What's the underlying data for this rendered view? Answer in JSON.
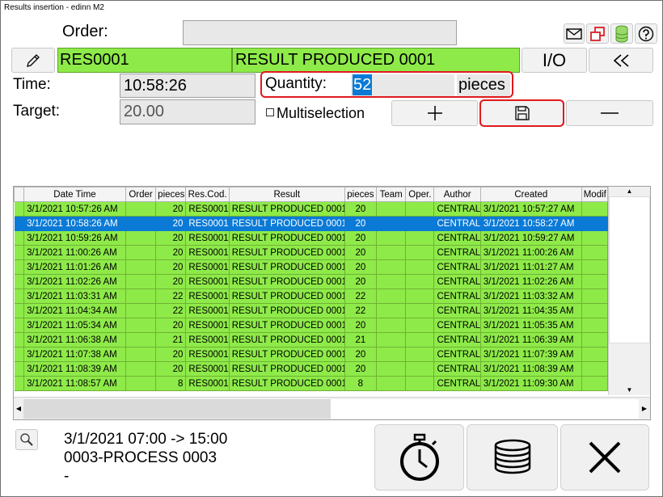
{
  "window": {
    "title": "Results insertion - edinn M2"
  },
  "form": {
    "order_label": "Order:",
    "order_value": "",
    "result_code": "RES0001",
    "result_name": "RESULT PRODUCED 0001",
    "io_label": "I/O",
    "time_label": "Time:",
    "time_value": "10:58:26",
    "quantity_label": "Quantity:",
    "quantity_value": "52",
    "quantity_unit": "pieces",
    "target_label": "Target:",
    "target_value": "20.00",
    "multiselection_label": "Multiselection"
  },
  "table": {
    "columns": [
      "Date Time",
      "Order",
      "pieces",
      "Res.Cod.",
      "Result",
      "pieces",
      "Team",
      "Oper.",
      "Author",
      "Created",
      "Modif"
    ],
    "rows": [
      [
        "3/1/2021 10:57:26 AM",
        "",
        "20",
        "RES0001",
        "RESULT PRODUCED 0001",
        "20",
        "",
        "",
        "CENTRAL",
        "3/1/2021 10:57:27 AM",
        ""
      ],
      [
        "3/1/2021 10:58:26 AM",
        "",
        "20",
        "RES0001",
        "RESULT PRODUCED 0001",
        "20",
        "",
        "",
        "CENTRAL",
        "3/1/2021 10:58:27 AM",
        ""
      ],
      [
        "3/1/2021 10:59:26 AM",
        "",
        "20",
        "RES0001",
        "RESULT PRODUCED 0001",
        "20",
        "",
        "",
        "CENTRAL",
        "3/1/2021 10:59:27 AM",
        ""
      ],
      [
        "3/1/2021 11:00:26 AM",
        "",
        "20",
        "RES0001",
        "RESULT PRODUCED 0001",
        "20",
        "",
        "",
        "CENTRAL",
        "3/1/2021 11:00:26 AM",
        ""
      ],
      [
        "3/1/2021 11:01:26 AM",
        "",
        "20",
        "RES0001",
        "RESULT PRODUCED 0001",
        "20",
        "",
        "",
        "CENTRAL",
        "3/1/2021 11:01:27 AM",
        ""
      ],
      [
        "3/1/2021 11:02:26 AM",
        "",
        "20",
        "RES0001",
        "RESULT PRODUCED 0001",
        "20",
        "",
        "",
        "CENTRAL",
        "3/1/2021 11:02:26 AM",
        ""
      ],
      [
        "3/1/2021 11:03:31 AM",
        "",
        "22",
        "RES0001",
        "RESULT PRODUCED 0001",
        "22",
        "",
        "",
        "CENTRAL",
        "3/1/2021 11:03:32 AM",
        ""
      ],
      [
        "3/1/2021 11:04:34 AM",
        "",
        "22",
        "RES0001",
        "RESULT PRODUCED 0001",
        "22",
        "",
        "",
        "CENTRAL",
        "3/1/2021 11:04:35 AM",
        ""
      ],
      [
        "3/1/2021 11:05:34 AM",
        "",
        "20",
        "RES0001",
        "RESULT PRODUCED 0001",
        "20",
        "",
        "",
        "CENTRAL",
        "3/1/2021 11:05:35 AM",
        ""
      ],
      [
        "3/1/2021 11:06:38 AM",
        "",
        "21",
        "RES0001",
        "RESULT PRODUCED 0001",
        "21",
        "",
        "",
        "CENTRAL",
        "3/1/2021 11:06:39 AM",
        ""
      ],
      [
        "3/1/2021 11:07:38 AM",
        "",
        "20",
        "RES0001",
        "RESULT PRODUCED 0001",
        "20",
        "",
        "",
        "CENTRAL",
        "3/1/2021 11:07:39 AM",
        ""
      ],
      [
        "3/1/2021 11:08:39 AM",
        "",
        "20",
        "RES0001",
        "RESULT PRODUCED 0001",
        "20",
        "",
        "",
        "CENTRAL",
        "3/1/2021 11:08:39 AM",
        ""
      ],
      [
        "3/1/2021 11:08:57 AM",
        "",
        "8",
        "RES0001",
        "RESULT PRODUCED 0001",
        "8",
        "",
        "",
        "CENTRAL",
        "3/1/2021 11:09:30 AM",
        ""
      ]
    ],
    "selected_row": 1
  },
  "footer": {
    "shift": "3/1/2021 07:00 -> 15:00",
    "process": "0003-PROCESS 0003",
    "extra": "-"
  },
  "icons": {
    "mail": "mail-icon",
    "windows": "windows-icon",
    "database": "database-icon",
    "help": "help-icon",
    "edit": "pencil-icon",
    "back": "double-chevron-left-icon",
    "add": "plus-icon",
    "save": "floppy-disk-icon",
    "remove": "minus-icon",
    "search": "magnifier-icon",
    "stopwatch": "stopwatch-icon",
    "coins": "coins-icon",
    "close": "close-icon"
  },
  "colors": {
    "row_green": "#8eea49",
    "selection_blue": "#0a7ad6",
    "highlight_red": "#e0191f"
  }
}
